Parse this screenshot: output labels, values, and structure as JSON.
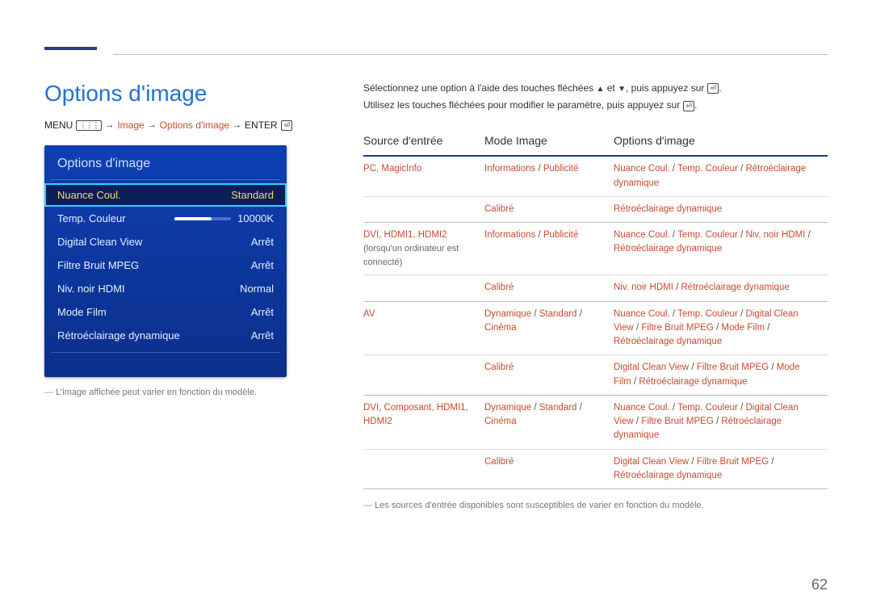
{
  "page_number": "62",
  "title": "Options d'image",
  "breadcrumb": {
    "menu": "MENU",
    "image": "Image",
    "options": "Options d'image",
    "enter": "ENTER"
  },
  "osd": {
    "title": "Options d'image",
    "rows": [
      {
        "label": "Nuance Coul.",
        "value": "Standard",
        "selected": true
      },
      {
        "label": "Temp. Couleur",
        "value": "10000K",
        "slider": true
      },
      {
        "label": "Digital Clean View",
        "value": "Arrêt"
      },
      {
        "label": "Filtre Bruit MPEG",
        "value": "Arrêt"
      },
      {
        "label": "Niv. noir HDMI",
        "value": "Normal"
      },
      {
        "label": "Mode Film",
        "value": "Arrêt"
      },
      {
        "label": "Rétroéclairage dynamique",
        "value": "Arrêt"
      }
    ],
    "note": "L'image affichée peut varier en fonction du modèle."
  },
  "instructions": {
    "line1a": "Sélectionnez une option à l'aide des touches fléchées ",
    "line1b": " et ",
    "line1c": ", puis appuyez sur ",
    "line1d": ".",
    "line2a": "Utilisez les touches fléchées pour modifier le paramètre, puis appuyez sur ",
    "line2b": "."
  },
  "table": {
    "headers": {
      "src": "Source d'entrée",
      "mode": "Mode Image",
      "opt": "Options d'image"
    },
    "rows": [
      {
        "src": "PC, MagicInfo",
        "mode_parts": [
          "Informations",
          "Publicité"
        ],
        "opt_parts": [
          "Nuance Coul.",
          "Temp. Couleur",
          "Rétroéclairage dynamique"
        ]
      },
      {
        "src": "",
        "mode_parts": [
          "Calibré"
        ],
        "opt_parts": [
          "Rétroéclairage dynamique"
        ],
        "group_end": true
      },
      {
        "src": "DVI, HDMI1, HDMI2",
        "subnote": "(lorsqu'un ordinateur est connecté)",
        "mode_parts": [
          "Informations",
          "Publicité"
        ],
        "opt_parts": [
          "Nuance Coul.",
          "Temp. Couleur",
          "Niv. noir HDMI",
          "Rétroéclairage dynamique"
        ]
      },
      {
        "src": "",
        "mode_parts": [
          "Calibré"
        ],
        "opt_parts": [
          "Niv. noir HDMI",
          "Rétroéclairage dynamique"
        ],
        "group_end": true
      },
      {
        "src": "AV",
        "mode_parts": [
          "Dynamique",
          "Standard",
          "Cinéma"
        ],
        "opt_parts": [
          "Nuance Coul.",
          "Temp. Couleur",
          "Digital Clean View",
          "Filtre Bruit MPEG",
          "Mode Film",
          "Rétroéclairage dynamique"
        ]
      },
      {
        "src": "",
        "mode_parts": [
          "Calibré"
        ],
        "opt_parts": [
          "Digital Clean View",
          "Filtre Bruit MPEG",
          "Mode Film",
          "Rétroéclairage dynamique"
        ],
        "group_end": true
      },
      {
        "src": "DVI, Composant, HDMI1, HDMI2",
        "mode_parts": [
          "Dynamique",
          "Standard",
          "Cinéma"
        ],
        "opt_parts": [
          "Nuance Coul.",
          "Temp. Couleur",
          "Digital Clean View",
          "Filtre Bruit MPEG",
          "Rétroéclairage dynamique"
        ]
      },
      {
        "src": "",
        "mode_parts": [
          "Calibré"
        ],
        "opt_parts": [
          "Digital Clean View",
          "Filtre Bruit MPEG",
          "Rétroéclairage dynamique"
        ],
        "group_end": true
      }
    ],
    "foot_note": "Les sources d'entrée disponibles sont susceptibles de varier en fonction du modèle."
  }
}
